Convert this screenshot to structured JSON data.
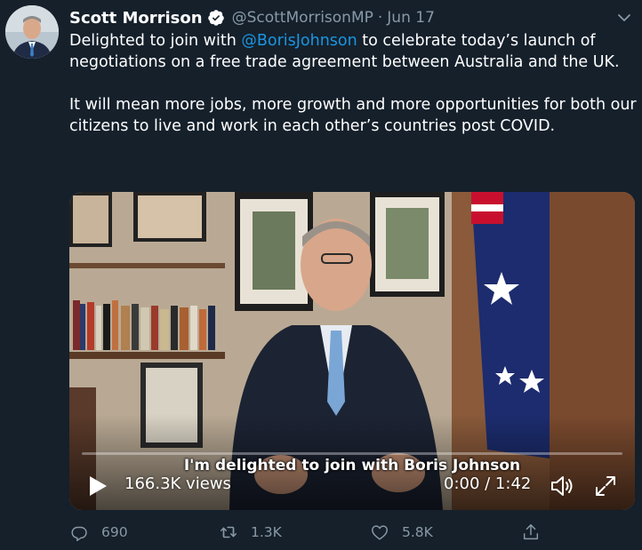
{
  "author": {
    "name": "Scott Morrison",
    "handle": "@ScottMorrisonMP",
    "separator": "·",
    "date": "Jun 17",
    "verified": true
  },
  "tweet": {
    "text_prefix": "Delighted to join with ",
    "mention": "@BorisJohnson",
    "text_suffix": " to celebrate today’s launch of negotiations on a free trade agreement between Australia and the UK.",
    "paragraph_2": "It will mean more jobs, more growth and more opportunities for both our citizens to live and work in each other’s countries post COVID."
  },
  "video": {
    "caption": "I'm delighted to join with Boris Johnson",
    "views": "166.3K views",
    "timecode": "0:00 / 1:42",
    "progress_fraction": 0
  },
  "actions": {
    "reply_count": "690",
    "retweet_count": "1.3K",
    "like_count": "5.8K"
  },
  "colors": {
    "background": "#15202b",
    "text": "#ffffff",
    "secondary": "#8899a6",
    "link": "#1b95e0",
    "verified": "#ffffff"
  },
  "icons": [
    "verified-badge-icon",
    "chevron-down-icon",
    "play-icon",
    "volume-icon",
    "fullscreen-icon",
    "reply-icon",
    "retweet-icon",
    "like-icon",
    "share-icon"
  ]
}
